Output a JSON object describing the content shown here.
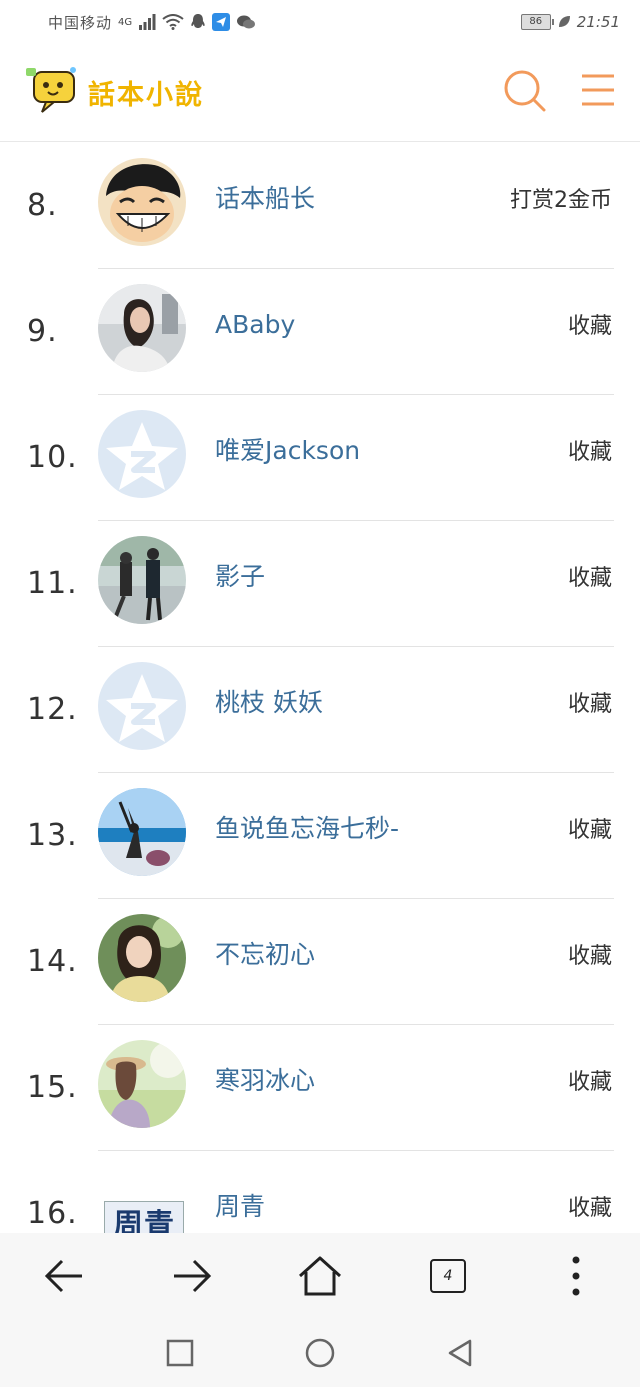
{
  "status_bar": {
    "carrier": "中国移动",
    "network": "4G",
    "battery": "86",
    "time": "21:51"
  },
  "app": {
    "logo_text": "話本小說",
    "brand_color": "#f0b400",
    "accent_color": "#f29a5b"
  },
  "list": {
    "items": [
      {
        "rank": "8.",
        "name": "话本船长",
        "action": "打赏2金币",
        "avatar": "cartoon"
      },
      {
        "rank": "9.",
        "name": "ABaby",
        "action": "收藏",
        "avatar": "photo"
      },
      {
        "rank": "10.",
        "name": "唯爱Jackson",
        "action": "收藏",
        "avatar": "default-qq"
      },
      {
        "rank": "11.",
        "name": "影子",
        "action": "收藏",
        "avatar": "photo"
      },
      {
        "rank": "12.",
        "name": "桃枝 妖妖",
        "action": "收藏",
        "avatar": "default-qq"
      },
      {
        "rank": "13.",
        "name": "鱼说鱼忘海七秒-",
        "action": "收藏",
        "avatar": "photo"
      },
      {
        "rank": "14.",
        "name": "不忘初心",
        "action": "收藏",
        "avatar": "photo"
      },
      {
        "rank": "15.",
        "name": "寒羽冰心",
        "action": "收藏",
        "avatar": "photo"
      },
      {
        "rank": "16.",
        "name": "周青",
        "action": "收藏",
        "avatar": "text",
        "avatar_text": "周青"
      }
    ]
  },
  "toolbar": {
    "tab_count": "4",
    "icons": [
      "back-arrow-icon",
      "forward-arrow-icon",
      "home-icon",
      "tabs-icon",
      "more-icon"
    ]
  },
  "navbar": {
    "icons": [
      "recents-square-icon",
      "home-circle-icon",
      "back-triangle-icon"
    ]
  }
}
